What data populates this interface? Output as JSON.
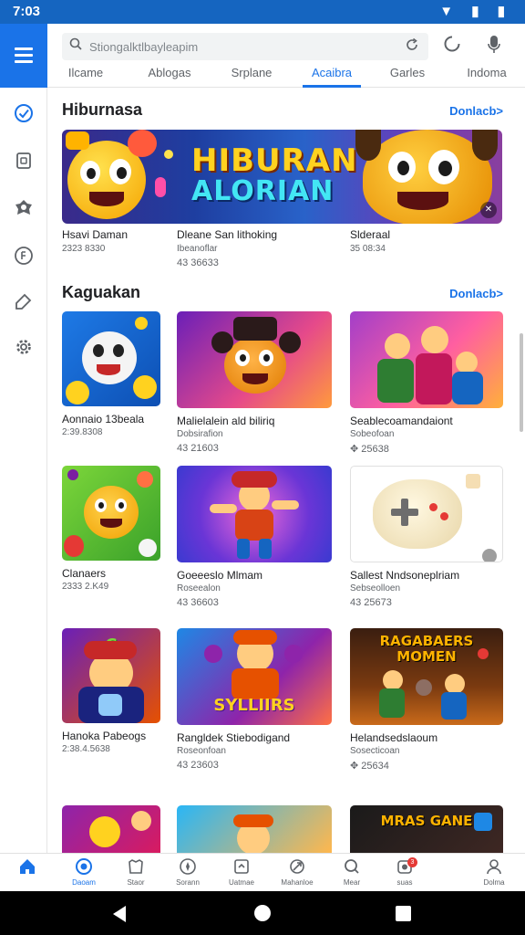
{
  "status_bar": {
    "time": "7:03",
    "icons": "▼ ▮ ▮"
  },
  "search": {
    "placeholder": "Stiongalktlbayleapim"
  },
  "tabs": [
    {
      "label": "Ilcame",
      "active": false
    },
    {
      "label": "Ablogas",
      "active": false
    },
    {
      "label": "Srplane",
      "active": false
    },
    {
      "label": "Acaibra",
      "active": true
    },
    {
      "label": "Garles",
      "active": false
    },
    {
      "label": "Indoma",
      "active": false
    }
  ],
  "featured": {
    "title": "Hiburnasa",
    "link": "Donlacb>",
    "banner": {
      "line1": "HIBURAN",
      "line2": "ALORIAN"
    },
    "items": [
      {
        "title": "Hsavi Daman",
        "sub": "2323 8330",
        "meta": ""
      },
      {
        "title": "Dleane San lithoking",
        "sub": "Ibeanoflar",
        "meta": "43 36633"
      },
      {
        "title": "Slderaal",
        "sub": "35 08:34",
        "meta": ""
      }
    ]
  },
  "section2": {
    "title": "Kaguakan",
    "link": "Donlacb>",
    "cards": [
      {
        "title": "Aonnaio 13beala",
        "sub": "2:39.8308",
        "meta": ""
      },
      {
        "title": "Malielalein ald biliriq",
        "sub": "Dobsirafion",
        "meta": "43 21603"
      },
      {
        "title": "Seablecoamandaiont",
        "sub": "Sobeofoan",
        "meta": "25638"
      },
      {
        "title": "Clanaers",
        "sub": "2333 2.K49",
        "meta": ""
      },
      {
        "title": "Goeeeslo Mlmam",
        "sub": "Roseealon",
        "meta": "43 36603"
      },
      {
        "title": "Sallest Nndsoneplriam",
        "sub": "Sebseolloen",
        "meta": "43 25673"
      },
      {
        "title": "Hanoka Pabeogs",
        "sub": "2:38.4.5638",
        "meta": ""
      },
      {
        "title": "Rangldek Stiebodigand",
        "sub": "Roseonfoan",
        "meta": "43 23603"
      },
      {
        "title": "Helandsedslaoum",
        "sub": "Sosecticoan",
        "meta": "25634"
      }
    ]
  },
  "bottom_nav": [
    {
      "label": "",
      "icon": "home-icon",
      "active": true
    },
    {
      "label": "Daoam",
      "icon": "games-icon",
      "active": true
    },
    {
      "label": "Staor",
      "icon": "store-icon",
      "active": false
    },
    {
      "label": "Sorann",
      "icon": "compass-icon",
      "active": false
    },
    {
      "label": "Uatmae",
      "icon": "apps-icon",
      "active": false
    },
    {
      "label": "Mahanloe",
      "icon": "rocket-icon",
      "active": false
    },
    {
      "label": "Mear",
      "icon": "search-icon",
      "active": false
    },
    {
      "label": "suas",
      "icon": "notification-icon",
      "active": false,
      "badge": "3"
    },
    {
      "label": "Dolma",
      "icon": "account-icon",
      "active": false
    }
  ]
}
